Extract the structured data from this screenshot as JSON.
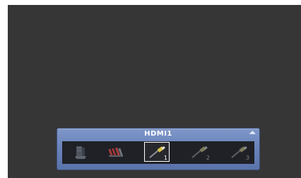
{
  "input_panel": {
    "title": "HDMI1",
    "arrows": "◢◣",
    "sources": [
      {
        "icon": "antenna-icon",
        "number": ""
      },
      {
        "icon": "component-cable-icon",
        "number": ""
      },
      {
        "icon": "hdmi-cable-icon",
        "number": "1",
        "selected": true
      },
      {
        "icon": "hdmi-cable-icon",
        "number": "2"
      },
      {
        "icon": "hdmi-cable-icon",
        "number": "3"
      }
    ]
  }
}
